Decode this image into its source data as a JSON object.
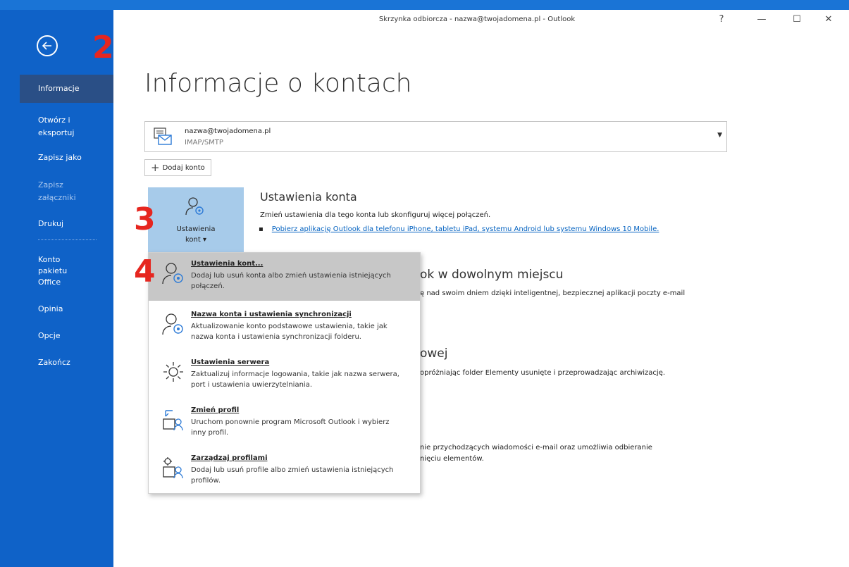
{
  "window": {
    "title": "Skrzynka odbiorcza - nazwa@twojadomena.pl - Outlook",
    "help": "?",
    "minimize": "—",
    "maximize": "☐",
    "close": "✕"
  },
  "sidebar": {
    "items": [
      {
        "label": "Informacje"
      },
      {
        "label": "Otwórz i eksportuj"
      },
      {
        "label": "Zapisz jako"
      },
      {
        "label": "Zapisz załączniki"
      },
      {
        "label": "Drukuj"
      },
      {
        "label": "Konto pakietu Office"
      },
      {
        "label": "Opinia"
      },
      {
        "label": "Opcje"
      },
      {
        "label": "Zakończ"
      }
    ]
  },
  "page": {
    "title": "Informacje o kontach"
  },
  "account": {
    "email": "nazwa@twojadomena.pl",
    "type": "IMAP/SMTP",
    "add_label": "Dodaj konto"
  },
  "account_settings_button": {
    "line1": "Ustawienia",
    "line2": "kont ▾"
  },
  "sections": {
    "settings_title": "Ustawienia konta",
    "settings_desc": "Zmień ustawienia dla tego konta lub skonfiguruj więcej połączeń.",
    "settings_link": "Pobierz aplikację Outlook dla telefonu iPhone, tabletu iPad, systemu Android lub systemu Windows 10 Mobile.",
    "mobile_title_fragment": "ok w dowolnym miejscu",
    "mobile_desc_fragment": "ę nad swoim dniem dzięki inteligentnej, bezpiecznej aplikacji poczty e-mail",
    "mailbox_title_fragment": "owej",
    "mailbox_desc_fragment": "opróżniając folder Elementy usunięte i przeprowadzając archiwizację.",
    "rules_desc_line1": "nie przychodzących wiadomości e-mail oraz umożliwia odbieranie",
    "rules_desc_line2": "nięciu elementów."
  },
  "dropdown": {
    "items": [
      {
        "title": "Ustawienia kont...",
        "desc": "Dodaj lub usuń konta albo zmień ustawienia istniejących połączeń."
      },
      {
        "title": "Nazwa konta i ustawienia synchronizacji",
        "desc": "Aktualizowanie konto podstawowe ustawienia, takie jak nazwa konta i ustawienia synchronizacji folderu."
      },
      {
        "title": "Ustawienia serwera",
        "desc": "Zaktualizuj informacje logowania, takie jak nazwa serwera, port i ustawienia uwierzytelniania."
      },
      {
        "title": "Zmień profil",
        "desc": "Uruchom ponownie program Microsoft Outlook i wybierz inny profil."
      },
      {
        "title": "Zarządzaj profilami",
        "desc": "Dodaj lub usuń profile albo zmień ustawienia istniejących profilów."
      }
    ]
  },
  "annotations": {
    "step2": "2",
    "step3": "3",
    "step4": "4"
  },
  "colors": {
    "sidebar": "#0f62c8",
    "sidebar_active": "#2a4f86",
    "button_highlight": "#a7cbea",
    "link": "#0563c1",
    "annotation": "#e6261f"
  }
}
